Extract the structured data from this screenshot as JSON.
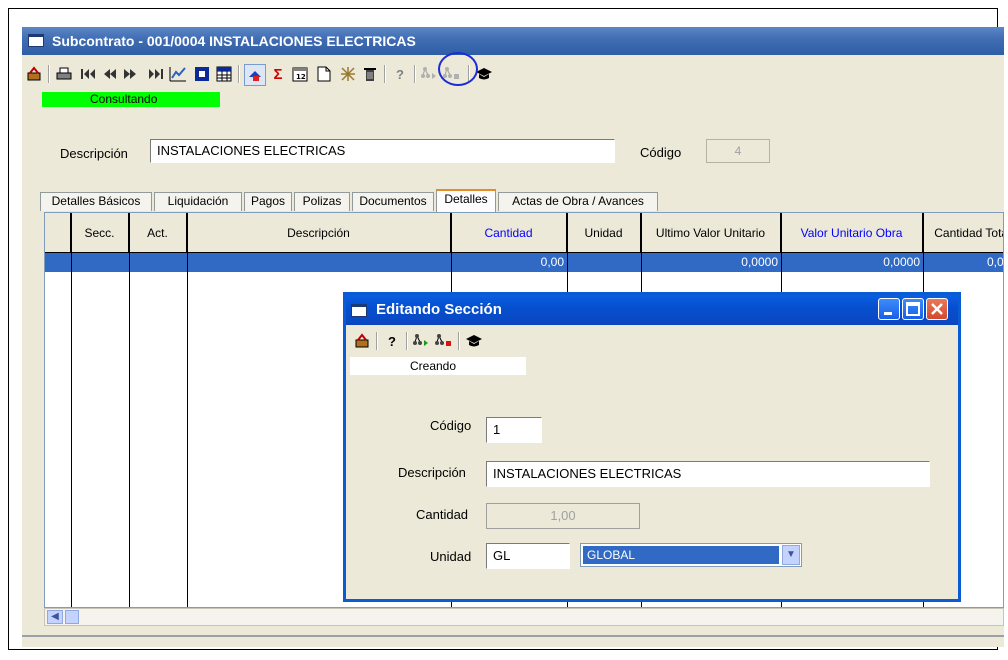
{
  "window": {
    "title": "Subcontrato - 001/0004 INSTALACIONES ELECTRICAS"
  },
  "toolbar": {
    "icons": [
      "exit-icon",
      "print-icon",
      "first-record-icon",
      "previous-record-icon",
      "next-record-icon",
      "last-record-icon",
      "chart-icon",
      "form-icon",
      "grid-icon",
      "color-icon",
      "sum-icon",
      "calendar-icon",
      "new-document-icon",
      "clear-icon",
      "delete-icon",
      "help-icon",
      "add-node-icon",
      "remove-node-icon",
      "hat-icon"
    ],
    "glyphs": {
      "sum": "Σ",
      "help": "?"
    }
  },
  "status": {
    "text": "Consultando",
    "color": "#00ff00"
  },
  "form": {
    "description_label": "Descripción",
    "description_value": "INSTALACIONES ELECTRICAS",
    "code_label": "Código",
    "code_value": "4"
  },
  "tabs": [
    {
      "label": "Detalles Básicos"
    },
    {
      "label": "Liquidación"
    },
    {
      "label": "Pagos"
    },
    {
      "label": "Polizas"
    },
    {
      "label": "Documentos"
    },
    {
      "label": "Detalles",
      "active": true
    },
    {
      "label": "Actas de Obra / Avances"
    }
  ],
  "grid": {
    "columns": [
      "Secc.",
      "Act.",
      "Descripción",
      "Cantidad",
      "Unidad",
      "Ultimo Valor Unitario",
      "Valor Unitario Obra",
      "Cantidad Total"
    ],
    "selected_row": {
      "cantidad": "0,00",
      "ultimo_valor_unitario": "0,0000",
      "valor_unitario_obra": "0,0000",
      "cantidad_total": "0,0"
    }
  },
  "dialog": {
    "title": "Editando Sección",
    "status": "Creando",
    "code_label": "Código",
    "code_value": "1",
    "description_label": "Descripción",
    "description_value": "INSTALACIONES ELECTRICAS",
    "quantity_label": "Cantidad",
    "quantity_value": "1,00",
    "unit_label": "Unidad",
    "unit_code": "GL",
    "unit_name": "GLOBAL",
    "help_glyph": "?"
  },
  "colors": {
    "titlebar": "#3f6cb2",
    "dialog_titlebar": "#0650d0",
    "selection": "#316ac5",
    "blue_header_text": "#0000ff",
    "highlight_circle": "#1b2bd6"
  }
}
